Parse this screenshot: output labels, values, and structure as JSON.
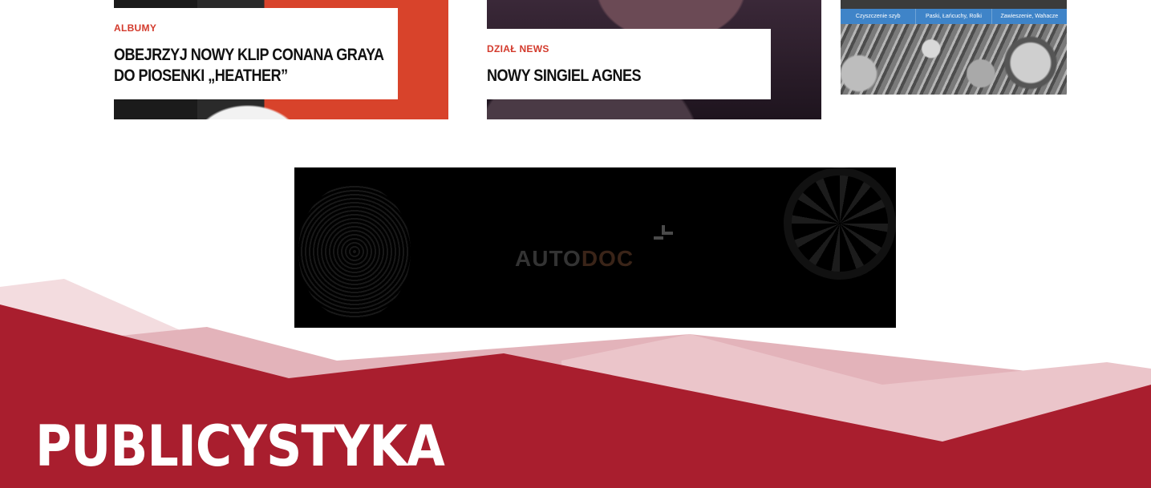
{
  "articles": [
    {
      "category": "ALBUMY",
      "title": "OBEJRZYJ NOWY KLIP CONANA GRAYA DO PIOSENKI „HEATHER”"
    },
    {
      "category": "DZIAŁ NEWS",
      "title": "NOWY SINGIEL AGNES"
    }
  ],
  "side_ad": {
    "tabs": [
      "Czyszczenie szyb",
      "Paski, Łańcuchy, Rolki",
      "Zawieszenie, Wahacze"
    ]
  },
  "banner_ad": {
    "logo_text_1": "AUTO",
    "logo_text_2": "DOC"
  },
  "section": {
    "title": "PUBLICYSTYKA"
  },
  "colors": {
    "brand_red": "#a91e2e",
    "category_red": "#d33a2c"
  }
}
